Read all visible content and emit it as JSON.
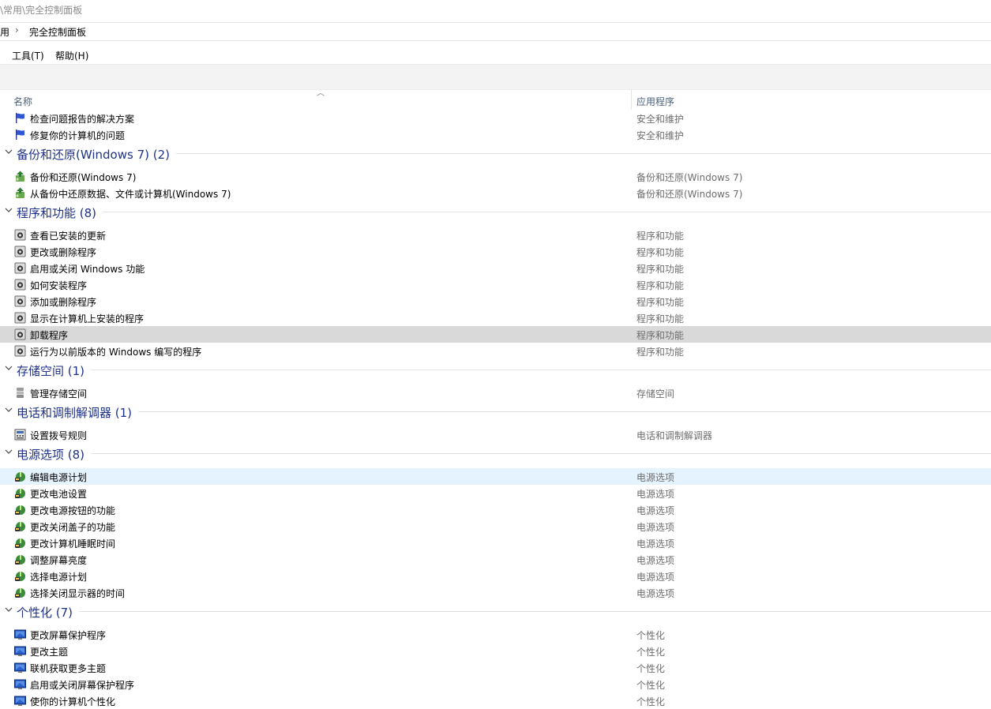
{
  "window": {
    "path_text": "\\常用\\完全控制面板"
  },
  "address": {
    "segment1": "用",
    "segment2": "完全控制面板"
  },
  "menu": {
    "tools": "工具(T)",
    "help": "帮助(H)"
  },
  "columns": {
    "name": "名称",
    "category": "应用程序"
  },
  "top_items": [
    {
      "label": "检查问题报告的解决方案",
      "category": "安全和维护",
      "icon": "flag-icon"
    },
    {
      "label": "修复你的计算机的问题",
      "category": "安全和维护",
      "icon": "flag-icon"
    }
  ],
  "groups": [
    {
      "title": "备份和还原(Windows 7) (2)",
      "icon": "backup-icon",
      "items": [
        {
          "label": "备份和还原(Windows 7)",
          "category": "备份和还原(Windows 7)"
        },
        {
          "label": "从备份中还原数据、文件或计算机(Windows 7)",
          "category": "备份和还原(Windows 7)"
        }
      ]
    },
    {
      "title": "程序和功能 (8)",
      "icon": "programs-icon",
      "items": [
        {
          "label": "查看已安装的更新",
          "category": "程序和功能"
        },
        {
          "label": "更改或删除程序",
          "category": "程序和功能"
        },
        {
          "label": "启用或关闭 Windows 功能",
          "category": "程序和功能"
        },
        {
          "label": "如何安装程序",
          "category": "程序和功能"
        },
        {
          "label": "添加或删除程序",
          "category": "程序和功能"
        },
        {
          "label": "显示在计算机上安装的程序",
          "category": "程序和功能"
        },
        {
          "label": "卸载程序",
          "category": "程序和功能",
          "selected": true
        },
        {
          "label": "运行为以前版本的 Windows 编写的程序",
          "category": "程序和功能"
        }
      ]
    },
    {
      "title": "存储空间 (1)",
      "icon": "storage-icon",
      "items": [
        {
          "label": "管理存储空间",
          "category": "存储空间"
        }
      ]
    },
    {
      "title": "电话和调制解调器 (1)",
      "icon": "phone-modem-icon",
      "items": [
        {
          "label": "设置拨号规则",
          "category": "电话和调制解调器"
        }
      ]
    },
    {
      "title": "电源选项 (8)",
      "icon": "power-icon",
      "items": [
        {
          "label": "编辑电源计划",
          "category": "电源选项",
          "hover": true
        },
        {
          "label": "更改电池设置",
          "category": "电源选项"
        },
        {
          "label": "更改电源按钮的功能",
          "category": "电源选项"
        },
        {
          "label": "更改关闭盖子的功能",
          "category": "电源选项"
        },
        {
          "label": "更改计算机睡眠时间",
          "category": "电源选项"
        },
        {
          "label": "调整屏幕亮度",
          "category": "电源选项"
        },
        {
          "label": "选择电源计划",
          "category": "电源选项"
        },
        {
          "label": "选择关闭显示器的时间",
          "category": "电源选项"
        }
      ]
    },
    {
      "title": "个性化 (7)",
      "icon": "personalization-icon",
      "items": [
        {
          "label": "更改屏幕保护程序",
          "category": "个性化"
        },
        {
          "label": "更改主题",
          "category": "个性化"
        },
        {
          "label": "联机获取更多主题",
          "category": "个性化"
        },
        {
          "label": "启用或关闭屏幕保护程序",
          "category": "个性化"
        },
        {
          "label": "使你的计算机个性化",
          "category": "个性化"
        }
      ]
    }
  ],
  "colors": {
    "group_header": "#1e3287",
    "selected_row": "#d9d9d9",
    "hover_row": "#e5f3ff",
    "category_text": "#6d6d6d",
    "column_header": "#4c607a"
  }
}
